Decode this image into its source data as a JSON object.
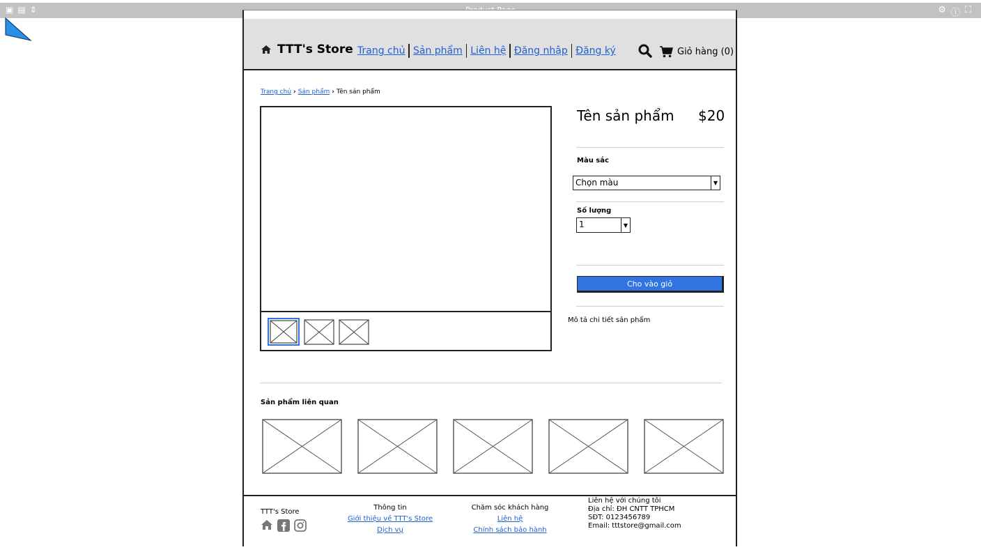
{
  "window": {
    "title": "Product Page"
  },
  "header": {
    "brand": "TTT's Store",
    "nav": [
      "Trang chủ",
      "Sản phẩm",
      "Liên hệ",
      "Đăng nhập",
      "Đăng ký"
    ],
    "cart_label": "Giỏ hàng (0)"
  },
  "breadcrumb": {
    "home": "Trang chủ",
    "category": "Sản phẩm",
    "current": "Tên sản phẩm"
  },
  "product": {
    "name": "Tên sản phẩm",
    "price": "$20",
    "color_label": "Màu sắc",
    "color_value": "Chọn màu",
    "quantity_label": "Số lượng",
    "quantity_value": "1",
    "add_to_cart": "Cho vào giỏ",
    "description": "Mô tả chi tiết sản phẩm"
  },
  "related": {
    "title": "Sản phẩm liên quan"
  },
  "footer": {
    "brand": "TTT's Store",
    "info_title": "Thông tin",
    "info_links": [
      "Giới thiệu về TTT's Store",
      "Dịch vụ"
    ],
    "care_title": "Chăm sóc khách hàng",
    "care_links": [
      "Liên hệ",
      "Chính sách bảo hành"
    ],
    "contact_title": "Liên hệ với chúng tôi",
    "address": "Địa chỉ: ĐH CNTT TPHCM",
    "phone": "SĐT: 0123456789",
    "email": "Email: tttstore@gmail.com"
  },
  "colors": {
    "accent": "#2f74e0",
    "link": "#1f5fd6",
    "header_bg": "#e0e0e0",
    "toolbar_bg": "#c2c2c2"
  }
}
